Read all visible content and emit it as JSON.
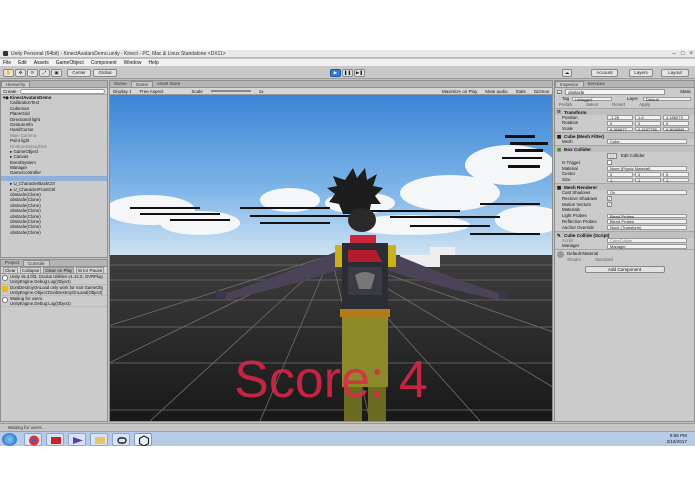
{
  "window": {
    "title": "Unity Personal (64bit) - KinectAvatarsDemo.unity - Kinect - PC, Mac & Linux Standalone <DX11>"
  },
  "menu": [
    "File",
    "Edit",
    "Assets",
    "GameObject",
    "Component",
    "Window",
    "Help"
  ],
  "toolbar": {
    "center_label": "Center",
    "global_label": "Global",
    "account_label": "Account",
    "layers_label": "Layers",
    "layout_label": "Layout"
  },
  "hierarchy": {
    "tab": "Hierarchy",
    "create_label": "Create",
    "scene_name": "KinectAvatarsDemo",
    "items": [
      {
        "label": "CalibrationText",
        "indent": 1,
        "style": ""
      },
      {
        "label": "Cubeman",
        "indent": 1,
        "style": ""
      },
      {
        "label": "PlaneGrid",
        "indent": 1,
        "style": ""
      },
      {
        "label": "Directional light",
        "indent": 1,
        "style": ""
      },
      {
        "label": "GestureInfo",
        "indent": 1,
        "style": ""
      },
      {
        "label": "HandCursor",
        "indent": 1,
        "style": ""
      },
      {
        "label": "Main Camera",
        "indent": 1,
        "style": "gray"
      },
      {
        "label": "Point light",
        "indent": 1,
        "style": ""
      },
      {
        "label": "GestureDebugText",
        "indent": 1,
        "style": "gray"
      },
      {
        "label": "GameObject",
        "indent": 1,
        "style": "expand"
      },
      {
        "label": "Canvas",
        "indent": 1,
        "style": "expand"
      },
      {
        "label": "EventSystem",
        "indent": 1,
        "style": ""
      },
      {
        "label": "Manager",
        "indent": 1,
        "style": ""
      },
      {
        "label": "GameController",
        "indent": 1,
        "style": ""
      },
      {
        "label": "",
        "indent": 1,
        "style": "sel"
      },
      {
        "label": "U_CharacterBackCtrl",
        "indent": 1,
        "style": "expand"
      },
      {
        "label": "U_CharacterFrontCtrl",
        "indent": 1,
        "style": "expand"
      },
      {
        "label": "obstacle(Clone)",
        "indent": 1,
        "style": ""
      },
      {
        "label": "obstacle(Clone)",
        "indent": 1,
        "style": ""
      },
      {
        "label": "obstacle(Clone)",
        "indent": 1,
        "style": ""
      },
      {
        "label": "obstacle(Clone)",
        "indent": 1,
        "style": ""
      },
      {
        "label": "obstacle(Clone)",
        "indent": 1,
        "style": ""
      },
      {
        "label": "obstacle(Clone)",
        "indent": 1,
        "style": ""
      },
      {
        "label": "obstacle(Clone)",
        "indent": 1,
        "style": ""
      },
      {
        "label": "obstacle(Clone)",
        "indent": 1,
        "style": ""
      }
    ]
  },
  "console": {
    "tabs": [
      "Project",
      "Console"
    ],
    "buttons": [
      "Clear",
      "Collapse",
      "Clear on Play",
      "Error Pause"
    ],
    "logs": [
      {
        "line1": "Unity v5.4.0f3, Oculus Utilities v1.12.0, OVRPlug",
        "line2": "UnityEngine.Debug:Log(Object)",
        "level": "info"
      },
      {
        "line1": "DontDestroyOnLoad only work for root GameObj",
        "line2": "UnityEngine.Object:DontDestroyOnLoad(Object)",
        "level": "warning"
      },
      {
        "line1": "Waiting for users.",
        "line2": "UnityEngine.Debug:Log(Object)",
        "level": "info"
      }
    ]
  },
  "scene_tabs": [
    "Scene",
    "Game",
    "Asset Store"
  ],
  "game_bar": {
    "display": "Display 1",
    "aspect": "Free Aspect",
    "scale_label": "Scale",
    "scale_value": "1x",
    "toggles": [
      "Maximize on Play",
      "Mute audio",
      "Stats",
      "Gizmos"
    ]
  },
  "game": {
    "score_text": "Score: 4",
    "score_color": "#e0264a"
  },
  "inspector": {
    "tabs": [
      "Inspector",
      "Services"
    ],
    "object_name": "obstacle",
    "static_label": "Static",
    "tag_label": "Tag",
    "tag_value": "Untagged",
    "layer_label": "Layer",
    "layer_value": "Default",
    "prefab_buttons": [
      "Prefab",
      "Select",
      "Revert",
      "Apply"
    ],
    "transform": {
      "header": "Transform",
      "rows": [
        {
          "label": "Position",
          "x": "-1.26",
          "y": "1.6",
          "z": "4.186073"
        },
        {
          "label": "Rotation",
          "x": "0",
          "y": "0",
          "z": "0"
        },
        {
          "label": "Scale",
          "x": "0.360677",
          "y": "0.1537755",
          "z": "0.3040861"
        }
      ]
    },
    "mesh_filter": {
      "header": "Cube (Mesh Filter)",
      "mesh_label": "Mesh",
      "mesh_value": "Cube"
    },
    "box_collider": {
      "header": "Box Collider",
      "edit_label": "Edit Collider",
      "is_trigger": "Is Trigger",
      "material_label": "Material",
      "material_value": "None (Physic Material)",
      "center_label": "Center",
      "center": [
        "0",
        "0",
        "0"
      ],
      "size_label": "Size",
      "size": [
        "1",
        "1",
        "1"
      ]
    },
    "mesh_renderer": {
      "header": "Mesh Renderer",
      "rows": [
        {
          "label": "Cast Shadows",
          "value": "On",
          "kind": "select"
        },
        {
          "label": "Receive Shadows",
          "value": "✓",
          "kind": "check"
        },
        {
          "label": "Motion Vectors",
          "value": "✓",
          "kind": "check"
        },
        {
          "label": "Materials",
          "value": "",
          "kind": "label"
        },
        {
          "label": "Light Probes",
          "value": "Blend Probes",
          "kind": "select"
        },
        {
          "label": "Reflection Probes",
          "value": "Blend Probes",
          "kind": "select"
        },
        {
          "label": "Anchor Override",
          "value": "None (Transform)",
          "kind": "select"
        }
      ]
    },
    "script": {
      "header": "Cube Collide (Script)",
      "script_label": "Script",
      "script_value": "CubeCollide",
      "manager_label": "Manager",
      "manager_value": "Manager"
    },
    "material": {
      "name": "Default-Material",
      "shader_label": "Shader",
      "shader_value": "Standard"
    },
    "add_component": "Add Component"
  },
  "status": {
    "text": "Waiting for users."
  },
  "taskbar": {
    "time": "9:56 PM",
    "date": "2/16/2017"
  }
}
